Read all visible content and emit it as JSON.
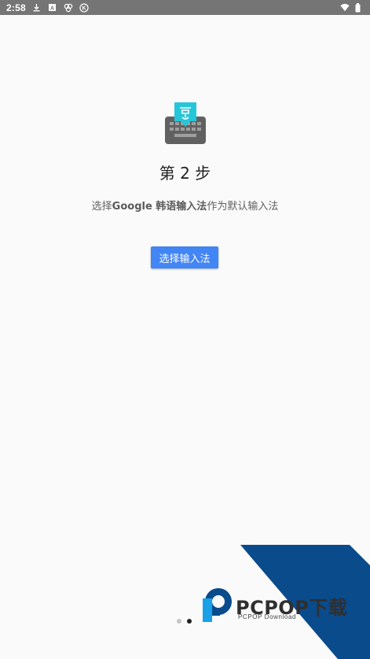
{
  "status_bar": {
    "time": "2:58",
    "icons": [
      "download-icon",
      "keyboard-a-icon",
      "gbs-icon",
      "k-circle-icon",
      "wifi-icon",
      "battery-icon"
    ]
  },
  "setup": {
    "step_title": "第 2 步",
    "instruction_prefix": "选择",
    "instruction_highlight": "Google 韩语输入法",
    "instruction_suffix": "作为默认输入法",
    "button_label": "选择输入法"
  },
  "pager": {
    "total": 2,
    "active_index": 1
  },
  "watermark": {
    "brand": "PCPOP下载",
    "subtitle": "PCPOP Download"
  },
  "colors": {
    "accent": "#4285f4",
    "status_bar": "#757575",
    "background": "#fafafa",
    "logo_teal": "#26c6da",
    "watermark_blue": "#0a4b8c",
    "watermark_light_blue": "#1aa0e6"
  }
}
